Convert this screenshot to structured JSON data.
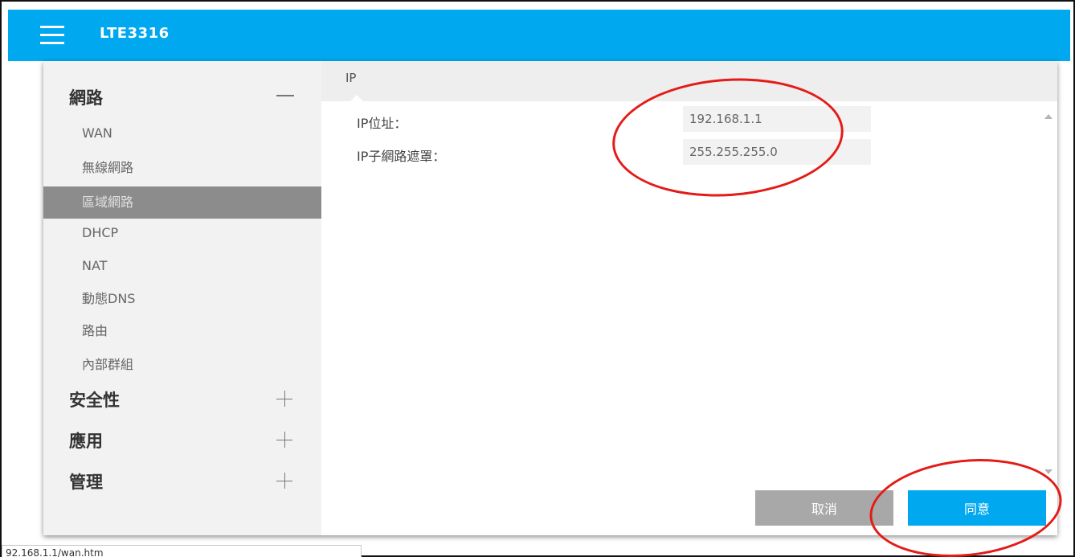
{
  "header": {
    "title": "LTE3316"
  },
  "sidebar": {
    "categories": [
      {
        "label": "網路",
        "toggle": "minus-icon"
      },
      {
        "label": "安全性",
        "toggle": "plus-icon"
      },
      {
        "label": "應用",
        "toggle": "plus-icon"
      },
      {
        "label": "管理",
        "toggle": "plus-icon"
      }
    ],
    "items": [
      {
        "label": "WAN"
      },
      {
        "label": "無線網路"
      },
      {
        "label": "區域網路",
        "active": true
      },
      {
        "label": "DHCP"
      },
      {
        "label": "NAT"
      },
      {
        "label": "動態DNS"
      },
      {
        "label": "路由"
      },
      {
        "label": "內部群組"
      }
    ]
  },
  "content": {
    "tab": "IP",
    "fields": [
      {
        "label": "IP位址：",
        "value": "192.168.1.1"
      },
      {
        "label": "IP子網路遮罩：",
        "value": "255.255.255.0"
      }
    ]
  },
  "buttons": {
    "cancel": "取消",
    "agree": "同意"
  },
  "status_bar": {
    "text": "92.168.1.1/wan.htm"
  },
  "colors": {
    "accent": "#00a8f0",
    "annotation": "#e41b17",
    "active_item": "#8c8c8c",
    "cancel": "#a8a8a8"
  }
}
